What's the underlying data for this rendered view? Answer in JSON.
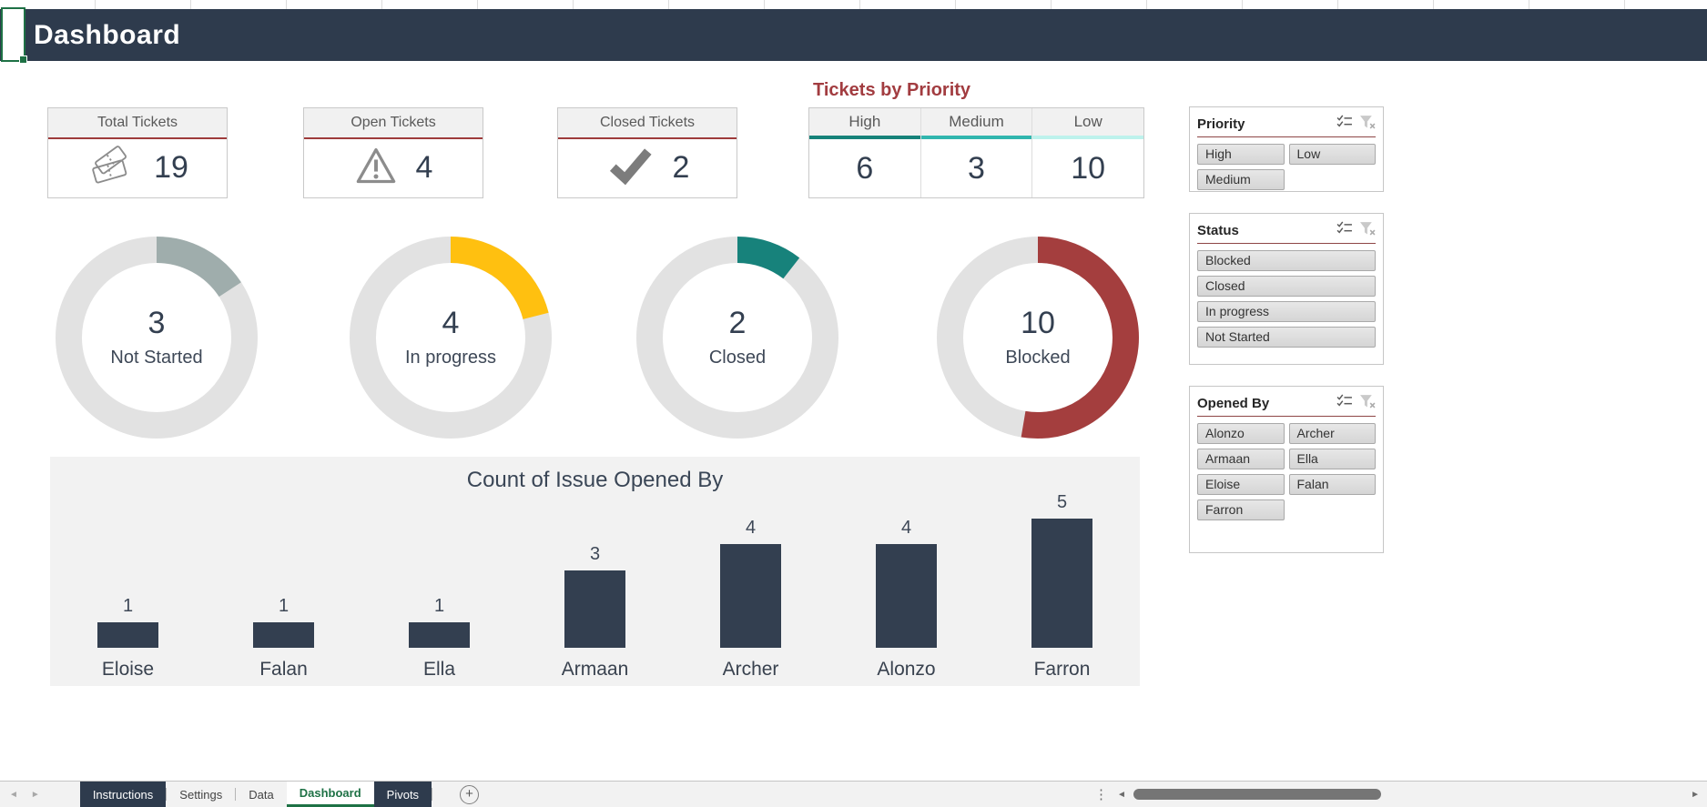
{
  "header": {
    "title": "Dashboard"
  },
  "kpi_cards": [
    {
      "label": "Total Tickets",
      "value": "19",
      "icon": "tickets-icon"
    },
    {
      "label": "Open Tickets",
      "value": "4",
      "icon": "warning-triangle-icon"
    },
    {
      "label": "Closed Tickets",
      "value": "2",
      "icon": "checkmark-icon"
    }
  ],
  "priority_table": {
    "title": "Tickets by Priority",
    "columns": [
      {
        "label": "High",
        "value": "6",
        "accent": "#16827A"
      },
      {
        "label": "Medium",
        "value": "3",
        "accent": "#31B6AE"
      },
      {
        "label": "Low",
        "value": "10",
        "accent": "#BDF2EC"
      }
    ]
  },
  "chart_data": [
    {
      "type": "bar",
      "title": "Count of Issue Opened By",
      "categories": [
        "Eloise",
        "Falan",
        "Ella",
        "Armaan",
        "Archer",
        "Alonzo",
        "Farron"
      ],
      "values": [
        1,
        1,
        1,
        3,
        4,
        4,
        5
      ],
      "bar_color": "#333F50",
      "background": "#F2F2F2",
      "data_labels": true,
      "xlabel": "",
      "ylabel": "",
      "ylim": [
        0,
        5.5
      ],
      "grid": false,
      "legend": false
    },
    {
      "type": "donut",
      "label": "Not Started",
      "value": 3,
      "total": 19,
      "color": "#9FADAC",
      "track_color": "#E2E2E2"
    },
    {
      "type": "donut",
      "label": "In progress",
      "value": 4,
      "total": 19,
      "color": "#FFC010",
      "track_color": "#E2E2E2"
    },
    {
      "type": "donut",
      "label": "Closed",
      "value": 2,
      "total": 19,
      "color": "#17827B",
      "track_color": "#E2E2E2"
    },
    {
      "type": "donut",
      "label": "Blocked",
      "value": 10,
      "total": 19,
      "color": "#A43E3E",
      "track_color": "#E2E2E2"
    }
  ],
  "slicers": [
    {
      "title": "Priority",
      "items": [
        "High",
        "Low",
        "Medium"
      ]
    },
    {
      "title": "Status",
      "items": [
        "Blocked",
        "Closed",
        "In progress",
        "Not Started"
      ]
    },
    {
      "title": "Opened By",
      "items": [
        "Alonzo",
        "Archer",
        "Armaan",
        "Ella",
        "Eloise",
        "Falan",
        "Farron"
      ]
    }
  ],
  "sheet_tabs": [
    {
      "label": "Instructions",
      "style": "dark"
    },
    {
      "label": "Settings",
      "style": "light"
    },
    {
      "label": "Data",
      "style": "light"
    },
    {
      "label": "Dashboard",
      "style": "active"
    },
    {
      "label": "Pivots",
      "style": "dark"
    }
  ],
  "colors": {
    "header_bg": "#2E3B4D",
    "accent_red": "#9E3B3B",
    "active_tab_green": "#1E7145",
    "kpi_number": "#333F50"
  }
}
